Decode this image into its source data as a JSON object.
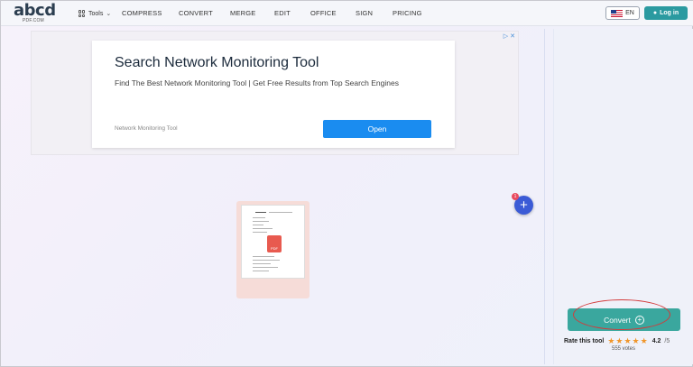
{
  "header": {
    "logo_word": "abcd",
    "logo_sub": "PDF.COM",
    "tools_label": "Tools",
    "nav": [
      "COMPRESS",
      "CONVERT",
      "MERGE",
      "EDIT",
      "OFFICE",
      "SIGN",
      "PRICING"
    ],
    "language": "EN",
    "login_label": "Log in"
  },
  "ad": {
    "title": "Search Network Monitoring Tool",
    "description": "Find The Best Network Monitoring Tool | Get Free Results from Top Search Engines",
    "source": "Network Monitoring Tool",
    "open_label": "Open",
    "marks": "▷ ✕"
  },
  "upload": {
    "badge_text": "PDF",
    "add_count": "1",
    "add_symbol": "+"
  },
  "sidebar": {
    "convert_label": "Convert",
    "rate_label": "Rate this tool",
    "stars": "★★★★★",
    "rating": "4.2",
    "rating_max": "/5",
    "votes": "555 votes"
  },
  "colors": {
    "accent": "#3aa79e",
    "login": "#2b9aa0",
    "open_button": "#1a8cf0",
    "highlight": "#d33a3a"
  }
}
